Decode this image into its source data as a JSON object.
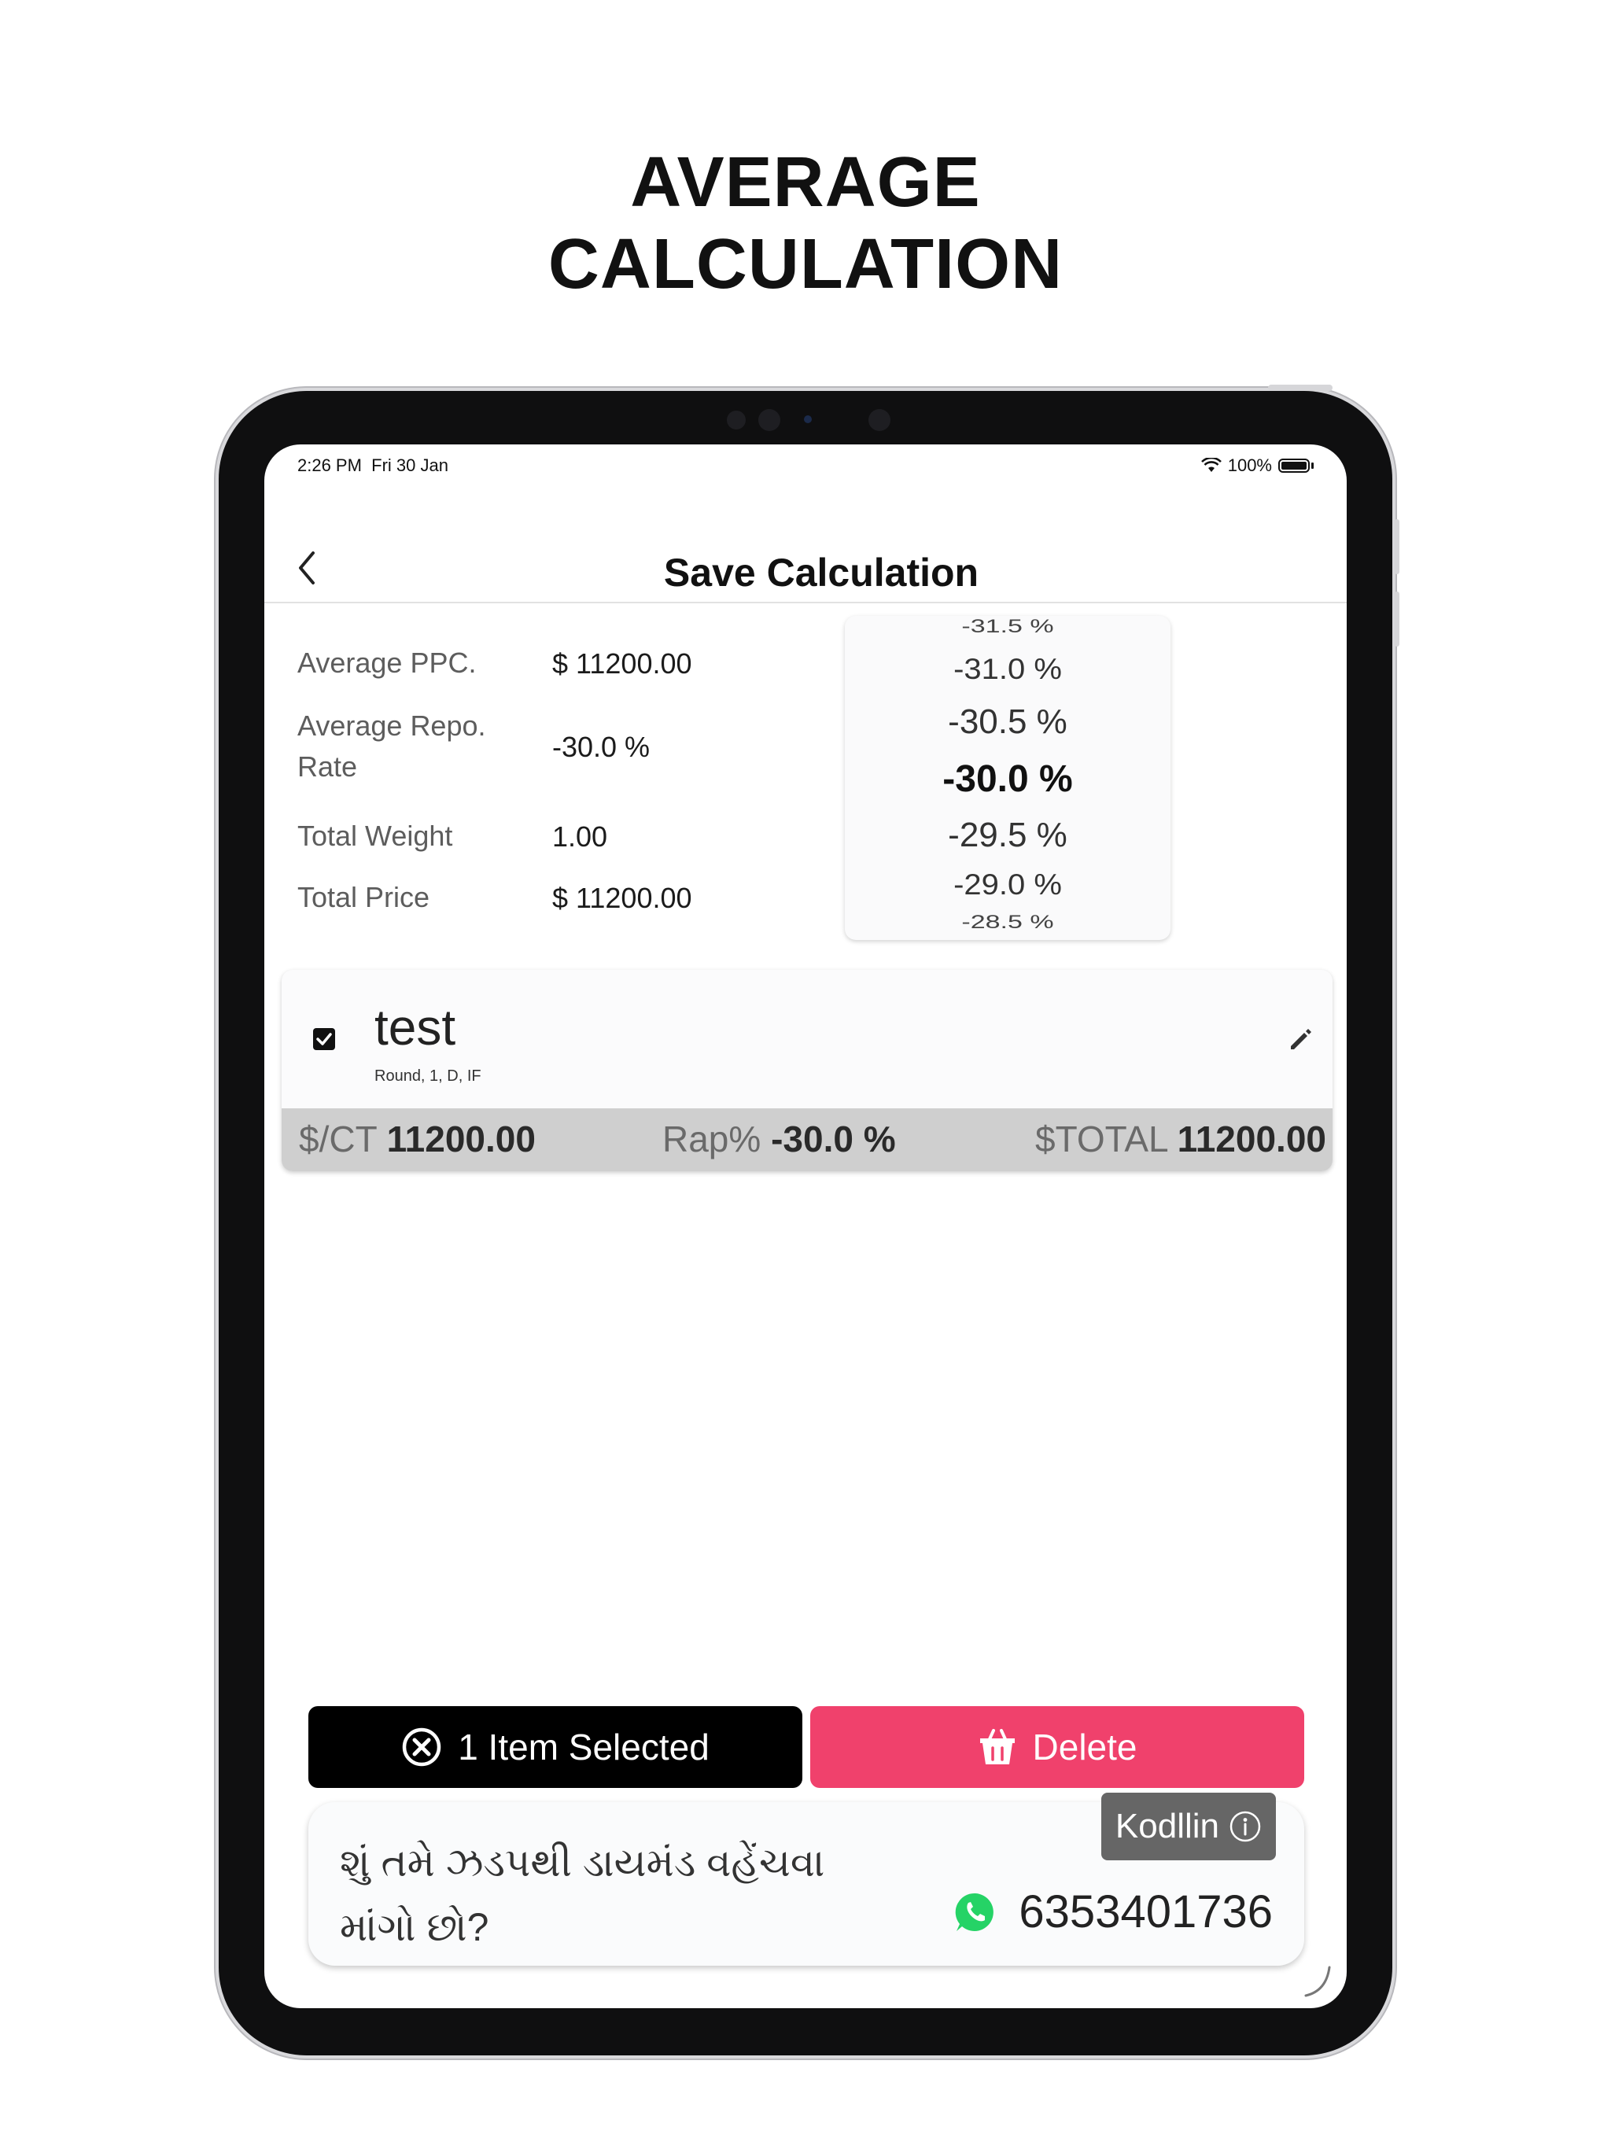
{
  "headline": {
    "line1": "AVERAGE",
    "line2": "CALCULATION"
  },
  "status": {
    "time": "2:26 PM",
    "date": "Fri 30 Jan",
    "battery": "100%"
  },
  "nav": {
    "title": "Save Calculation",
    "back_icon": "chevron-left-icon"
  },
  "summary": [
    {
      "label": "Average PPC.",
      "value": "$ 11200.00"
    },
    {
      "label": "Average Repo. Rate",
      "value": "-30.0 %"
    },
    {
      "label": "Total Weight",
      "value": "1.00"
    },
    {
      "label": "Total Price",
      "value": "$ 11200.00"
    }
  ],
  "picker": {
    "options": [
      "-31.5 %",
      "-31.0 %",
      "-30.5 %",
      "-30.0 %",
      "-29.5 %",
      "-29.0 %",
      "-28.5 %"
    ],
    "selected": "-30.0 %"
  },
  "item": {
    "name": "test",
    "details": "Round, 1, D, IF",
    "checked": true,
    "ct_label": "$/CT",
    "ct_value": "11200.00",
    "rap_label": "Rap%",
    "rap_value": "-30.0 %",
    "total_label": "$TOTAL",
    "total_value": "11200.00"
  },
  "actions": {
    "selected_label": "1 Item Selected",
    "delete_label": "Delete"
  },
  "ad": {
    "text": "શું તમે ઝડપથી ડાયમંડ વહેંચવા માંગો છો?",
    "badge": "Kodllin",
    "phone": "6353401736"
  },
  "colors": {
    "delete": "#f0416c",
    "selected_bg": "#000000",
    "strip": "#cfcfcf",
    "whatsapp": "#25d366"
  }
}
